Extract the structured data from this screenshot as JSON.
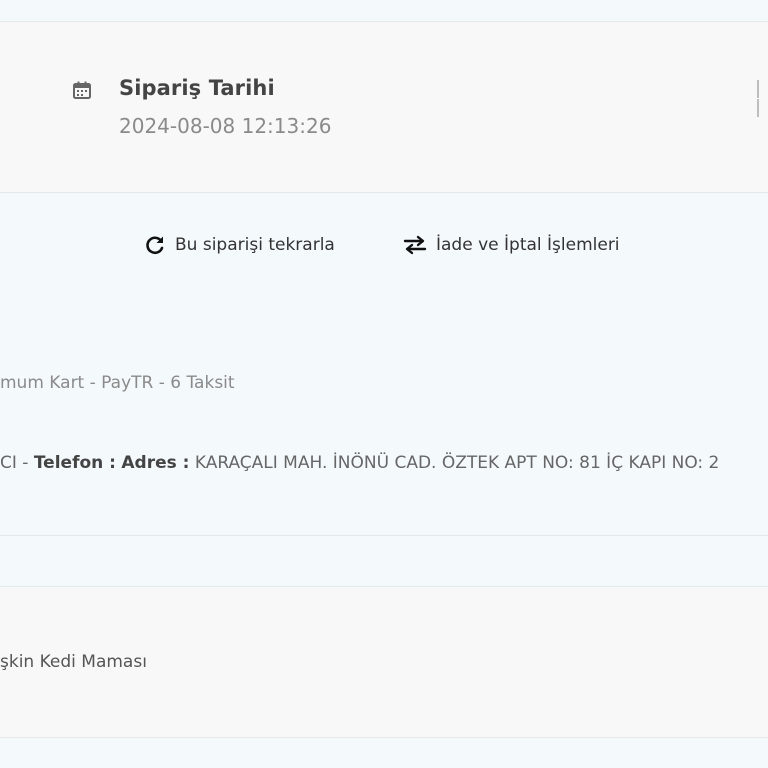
{
  "order_header": {
    "date_label": "Sipariş Tarihi",
    "date_value": "2024-08-08 12:13:26"
  },
  "actions": {
    "reorder_label": "Bu siparişi tekrarla",
    "refund_label": "İade ve İptal İşlemleri"
  },
  "payment": {
    "method_text": "mum Kart - PayTR - 6 Taksit"
  },
  "delivery": {
    "name_fragment": "CI",
    "separator": " - ",
    "phone_label": "Telefon :",
    "address_label": "Adres :",
    "address_value": "KARAÇALI MAH. İNÖNÜ CAD. ÖZTEK APT NO: 81 İÇ KAPI NO: 2"
  },
  "product": {
    "name": "şkin Kedi Maması"
  },
  "icons": {
    "calendar": "calendar-icon",
    "reorder": "refresh-icon",
    "refund": "swap-arrows-icon"
  }
}
